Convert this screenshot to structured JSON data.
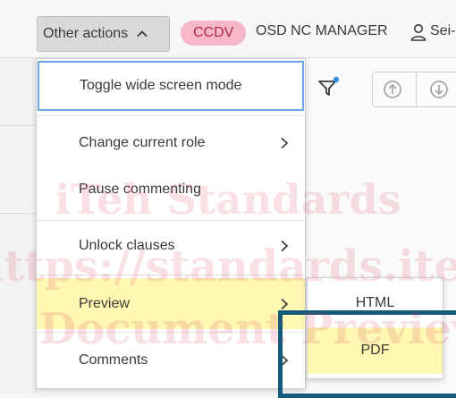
{
  "header": {
    "other_actions_label": "Other actions",
    "role_badge": "CCDV",
    "role_name": "OSD NC MANAGER",
    "user_name": "Sei-"
  },
  "menu": {
    "items": [
      {
        "label": "Toggle wide screen mode",
        "has_submenu": false,
        "state": "focused"
      },
      {
        "label": "Change current role",
        "has_submenu": true
      },
      {
        "label": "Pause commenting",
        "has_submenu": false
      },
      {
        "label": "Unlock clauses",
        "has_submenu": true
      },
      {
        "label": "Preview",
        "has_submenu": true,
        "state": "active"
      },
      {
        "label": "Comments",
        "has_submenu": true
      }
    ]
  },
  "submenu": {
    "items": [
      {
        "label": "HTML"
      },
      {
        "label": "PDF",
        "state": "active"
      }
    ]
  },
  "watermark": {
    "line1": "iTeh Standards",
    "line2": "https://standards.iteh.ai",
    "line3": "Document Preview"
  },
  "colors": {
    "badge_bg": "#f6b8c8",
    "badge_text": "#b2264e",
    "active_item_bg": "#fff7b2",
    "focus_border": "#6aa7e0",
    "highlight_border": "#145a7a",
    "filter_dot": "#3a8fd9"
  },
  "icons": {
    "other_actions_chevron": "chevron-up-icon",
    "user": "user-icon",
    "filter": "filter-icon",
    "navigate_up": "arrow-up-circle-icon",
    "navigate_down": "arrow-down-circle-icon",
    "submenu_arrow": "chevron-right-icon"
  }
}
